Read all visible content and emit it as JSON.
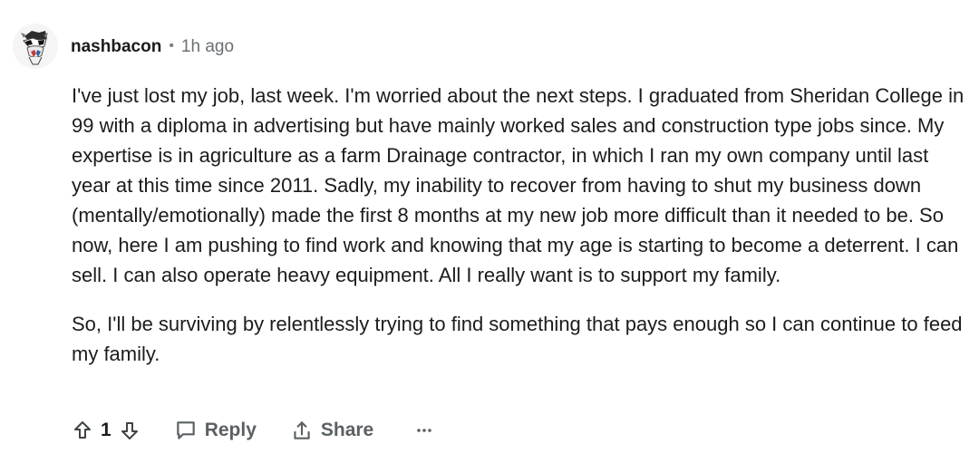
{
  "comment": {
    "username": "nashbacon",
    "separator": "•",
    "time": "1h ago",
    "paragraphs": [
      "I've just lost my job, last week. I'm worried about the next steps. I graduated from Sheridan College in 99 with a diploma in advertising but have mainly worked sales and construction type jobs since. My expertise is in agriculture as a farm Drainage contractor, in which I ran my own company until last year at this time since 2011. Sadly, my inability to recover from having to shut my business down (mentally/emotionally) made the first 8 months at my new job more difficult than it needed to be. So now, here I am pushing to find work and knowing that my age is starting to become a deterrent. I can sell. I can also operate heavy equipment. All I really want is to support my family.",
      "So, I'll be surviving by relentlessly trying to find something that pays enough so I can continue to feed my family."
    ],
    "actions": {
      "score": "1",
      "reply_label": "Reply",
      "share_label": "Share"
    }
  },
  "icons": {
    "avatar": "avatar-icon",
    "upvote": "upvote-icon",
    "downvote": "downvote-icon",
    "reply": "comment-bubble-icon",
    "share": "share-icon",
    "more": "more-icon"
  }
}
